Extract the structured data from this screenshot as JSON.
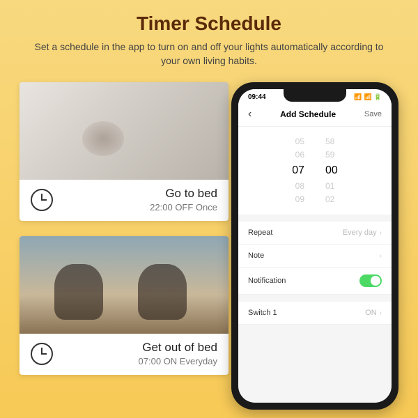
{
  "header": {
    "title": "Timer Schedule",
    "subtitle": "Set a schedule in the app to turn on and off your lights automatically according to your own living habits."
  },
  "cards": [
    {
      "title": "Go to bed",
      "sub": "22:00 OFF Once"
    },
    {
      "title": "Get out of bed",
      "sub": "07:00 ON Everyday"
    }
  ],
  "phone": {
    "status_time": "09:44",
    "nav": {
      "back": "‹",
      "title": "Add Schedule",
      "save": "Save"
    },
    "picker": {
      "rows": [
        {
          "h": "05",
          "m": "58"
        },
        {
          "h": "06",
          "m": "59"
        },
        {
          "h": "07",
          "m": "00"
        },
        {
          "h": "08",
          "m": "01"
        },
        {
          "h": "09",
          "m": "02"
        }
      ],
      "selected_index": 2
    },
    "settings": {
      "repeat": {
        "label": "Repeat",
        "value": "Every day"
      },
      "note": {
        "label": "Note",
        "value": ""
      },
      "notification": {
        "label": "Notification",
        "on": true
      },
      "switch1": {
        "label": "Switch 1",
        "value": "ON"
      }
    }
  }
}
